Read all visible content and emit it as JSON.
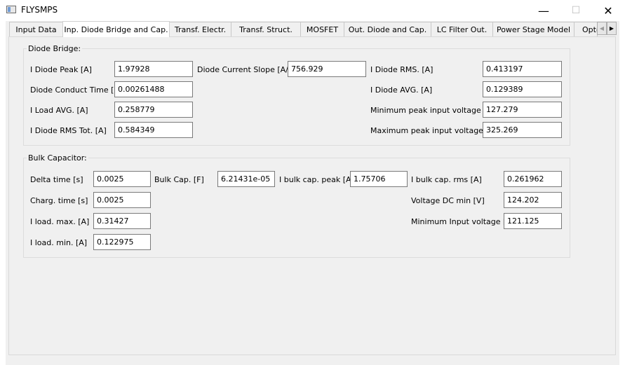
{
  "window": {
    "title": "FLYSMPS",
    "minimize_glyph": "—",
    "maximize_glyph": "☐",
    "close_glyph": "✕"
  },
  "tabs": [
    {
      "label": "Input Data",
      "active": false
    },
    {
      "label": "Inp. Diode Bridge and Cap.",
      "active": true
    },
    {
      "label": "Transf. Electr.",
      "active": false
    },
    {
      "label": "Transf. Struct.",
      "active": false
    },
    {
      "label": "MOSFET",
      "active": false
    },
    {
      "label": "Out. Diode and Cap.",
      "active": false
    },
    {
      "label": "LC Filter Out.",
      "active": false
    },
    {
      "label": "Power Stage Model",
      "active": false
    },
    {
      "label": "Opto",
      "active": false
    }
  ],
  "tab_scroll": {
    "left_glyph": "◀",
    "right_glyph": "▶"
  },
  "diode_bridge": {
    "title": "Diode Bridge:",
    "fields": [
      {
        "label": "I Diode Peak [A]",
        "value": "1.97928"
      },
      {
        "label": "Diode Current Slope [A/s]",
        "value": "756.929"
      },
      {
        "label": "I Diode RMS. [A]",
        "value": "0.413197"
      },
      {
        "label": "Diode Conduct Time [s]",
        "value": "0.00261488"
      },
      {
        "label": "I Diode AVG. [A]",
        "value": "0.129389"
      },
      {
        "label": "I Load AVG. [A]",
        "value": "0.258779"
      },
      {
        "label": "Minimum peak input voltage [V]",
        "value": "127.279"
      },
      {
        "label": "I Diode RMS Tot. [A]",
        "value": "0.584349"
      },
      {
        "label": "Maximum peak input voltage [V]",
        "value": "325.269"
      }
    ]
  },
  "bulk_capacitor": {
    "title": "Bulk Capacitor:",
    "fields": [
      {
        "label": "Delta time [s]",
        "value": "0.0025"
      },
      {
        "label": "Bulk Cap. [F]",
        "value": "6.21431e-05"
      },
      {
        "label": "I bulk cap. peak [A]",
        "value": "1.75706"
      },
      {
        "label": "I bulk cap. rms [A]",
        "value": "0.261962"
      },
      {
        "label": "Charg. time [s]",
        "value": "0.0025"
      },
      {
        "label": "Voltage DC min [V]",
        "value": "124.202"
      },
      {
        "label": "I load. max. [A]",
        "value": "0.31427"
      },
      {
        "label": "Minimum Input voltage [V]",
        "value": "121.125"
      },
      {
        "label": "I load. min. [A]",
        "value": "0.122975"
      }
    ]
  }
}
